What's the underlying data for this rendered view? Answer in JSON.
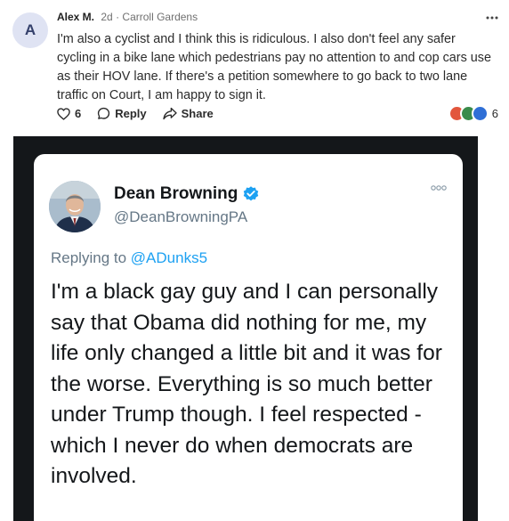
{
  "comment": {
    "avatar_letter": "A",
    "author": "Alex M.",
    "time": "2d",
    "separator": "·",
    "location": "Carroll Gardens",
    "more_icon": "more-horizontal-icon",
    "body": "I'm also a cyclist and I think this is ridiculous. I also don't feel any safer cycling in a bike lane which pedestrians pay no attention to and cop cars use as their HOV lane. If there's a petition somewhere to go back to two lane traffic on Court, I am happy to sign it.",
    "actions": {
      "like_count": "6",
      "reply_label": "Reply",
      "share_label": "Share"
    },
    "reaction_count": "6",
    "colors": {
      "avatar_bg": "#dfe3f3",
      "avatar_fg": "#34406b",
      "reaction_1": "#e2563c",
      "reaction_2": "#3a8b4a",
      "reaction_3": "#2f6fd6"
    }
  },
  "tweet": {
    "name": "Dean Browning",
    "handle": "@DeanBrowningPA",
    "replying_prefix": "Replying to",
    "replying_to": "@ADunks5",
    "text": "I'm a black gay guy and I can personally say that Obama did nothing for me, my life only changed a little bit and it was for the worse. Everything is so much better under Trump though. I feel respected - which I never do when democrats are involved.",
    "colors": {
      "verified": "#1da1f2",
      "mention": "#1da1f2",
      "frame_bg": "#14171a"
    }
  }
}
